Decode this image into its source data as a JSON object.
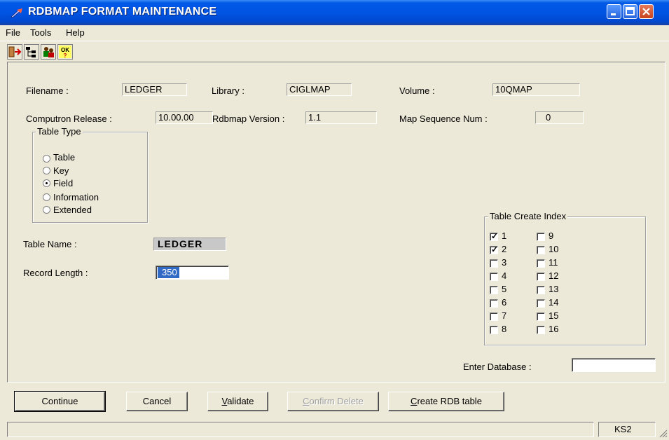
{
  "window": {
    "title": "RDBMAP FORMAT MAINTENANCE"
  },
  "menu": [
    "File",
    "Tools",
    "Help"
  ],
  "toolbar": {
    "ok_label": "OK"
  },
  "fields": {
    "filename": {
      "label": "Filename :",
      "value": "LEDGER"
    },
    "library": {
      "label": "Library :",
      "value": "CIGLMAP"
    },
    "volume": {
      "label": "Volume :",
      "value": "10QMAP"
    },
    "release": {
      "label": "Computron Release :",
      "value": "10.00.00"
    },
    "rdbmap_version": {
      "label": "Rdbmap Version :",
      "value": "1.1"
    },
    "map_seq": {
      "label": "Map Sequence Num :",
      "value": "0"
    },
    "table_name": {
      "label": "Table Name :",
      "value": "LEDGER"
    },
    "record_length": {
      "label": "Record Length :",
      "value": "350"
    },
    "enter_database": {
      "label": "Enter Database :",
      "value": ""
    }
  },
  "table_type": {
    "legend": "Table Type",
    "options": [
      {
        "label": "Table",
        "selected": false
      },
      {
        "label": "Key",
        "selected": false
      },
      {
        "label": "Field",
        "selected": true
      },
      {
        "label": "Information",
        "selected": false
      },
      {
        "label": "Extended",
        "selected": false
      }
    ]
  },
  "create_index": {
    "legend": "Table Create Index",
    "items": [
      {
        "label": "1",
        "checked": true
      },
      {
        "label": "2",
        "checked": true
      },
      {
        "label": "3",
        "checked": false
      },
      {
        "label": "4",
        "checked": false
      },
      {
        "label": "5",
        "checked": false
      },
      {
        "label": "6",
        "checked": false
      },
      {
        "label": "7",
        "checked": false
      },
      {
        "label": "8",
        "checked": false
      },
      {
        "label": "9",
        "checked": false
      },
      {
        "label": "10",
        "checked": false
      },
      {
        "label": "11",
        "checked": false
      },
      {
        "label": "12",
        "checked": false
      },
      {
        "label": "13",
        "checked": false
      },
      {
        "label": "14",
        "checked": false
      },
      {
        "label": "15",
        "checked": false
      },
      {
        "label": "16",
        "checked": false
      }
    ]
  },
  "buttons": {
    "continue": "Continue",
    "cancel": "Cancel",
    "validate_prefix": "V",
    "validate_rest": "alidate",
    "confirm_delete_prefix": "C",
    "confirm_delete_rest": "onfirm Delete",
    "create_rdb_prefix": "C",
    "create_rdb_rest": "reate RDB table"
  },
  "status": {
    "cell": "KS2"
  },
  "colors": {
    "titlebar": "#0054e3",
    "face": "#ece9d8",
    "selection": "#316ac5"
  }
}
